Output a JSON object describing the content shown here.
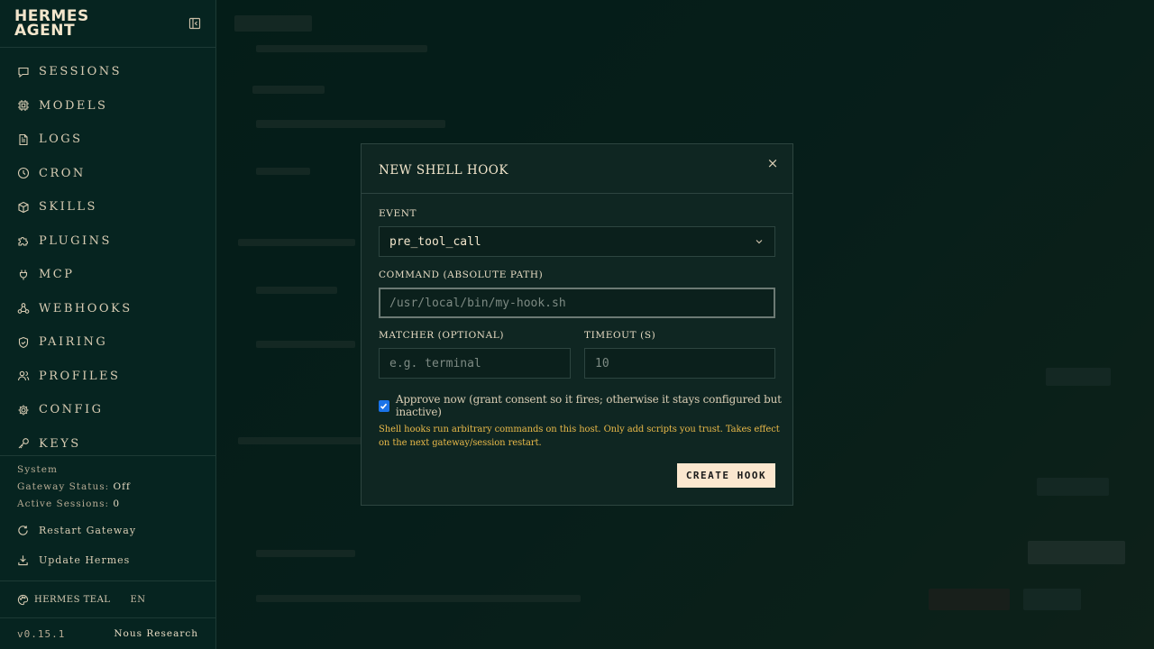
{
  "brand": {
    "line1": "HERMES",
    "line2": "AGENT"
  },
  "nav": {
    "items": [
      {
        "label": "SESSIONS",
        "icon": "chat-icon"
      },
      {
        "label": "MODELS",
        "icon": "chip-icon"
      },
      {
        "label": "LOGS",
        "icon": "file-text-icon"
      },
      {
        "label": "CRON",
        "icon": "clock-icon"
      },
      {
        "label": "SKILLS",
        "icon": "box-icon"
      },
      {
        "label": "PLUGINS",
        "icon": "puzzle-icon"
      },
      {
        "label": "MCP",
        "icon": "plug-icon"
      },
      {
        "label": "WEBHOOKS",
        "icon": "webhook-icon"
      },
      {
        "label": "PAIRING",
        "icon": "shield-check-icon"
      },
      {
        "label": "PROFILES",
        "icon": "users-icon"
      },
      {
        "label": "CONFIG",
        "icon": "gear-icon"
      },
      {
        "label": "KEYS",
        "icon": "key-icon"
      }
    ]
  },
  "system": {
    "heading": "System",
    "gateway_label": "Gateway Status:",
    "gateway_value": "Off",
    "sessions_label": "Active Sessions:",
    "sessions_value": "0",
    "restart_label": "Restart Gateway",
    "update_label": "Update Hermes"
  },
  "theme": {
    "name": "HERMES TEAL",
    "lang": "EN"
  },
  "footer": {
    "version": "v0.15.1",
    "org": "Nous Research"
  },
  "modal": {
    "title": "NEW SHELL HOOK",
    "close": "×",
    "event_label": "EVENT",
    "event_value": "pre_tool_call",
    "command_label": "COMMAND (ABSOLUTE PATH)",
    "command_placeholder": "/usr/local/bin/my-hook.sh",
    "matcher_label": "MATCHER (OPTIONAL)",
    "matcher_placeholder": "e.g. terminal",
    "timeout_label": "TIMEOUT (S)",
    "timeout_placeholder": "10",
    "approve_label": "Approve now (grant consent so it fires; otherwise it stays configured but inactive)",
    "approve_checked": true,
    "warning": "Shell hooks run arbitrary commands on this host. Only add scripts you trust. Takes effect on the next gateway/session restart.",
    "create_button": "CREATE HOOK"
  },
  "colors": {
    "accent": "#fbe7cf",
    "warning": "#e9b949",
    "checkbox": "#1a73e8",
    "sidebar_bg": "#062420"
  }
}
